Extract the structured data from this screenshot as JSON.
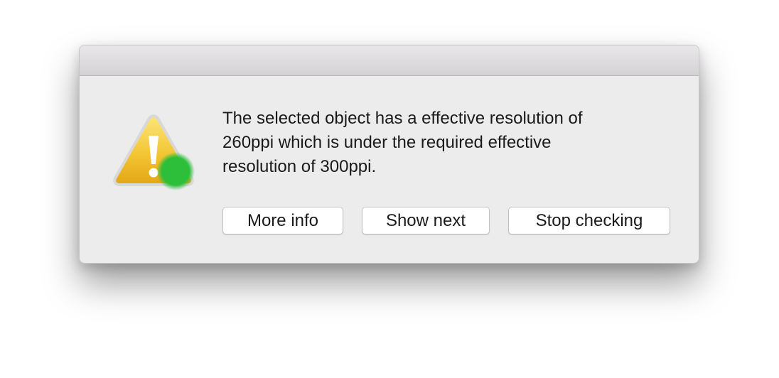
{
  "dialog": {
    "icon": "warning-icon",
    "message_line1": "The selected object has a effective resolution of",
    "message_line2": "260ppi which is under the required effective",
    "message_line3": "resolution of 300ppi.",
    "buttons": {
      "more_info": "More info",
      "show_next": "Show next",
      "stop_checking": "Stop checking"
    }
  },
  "colors": {
    "warning_yellow": "#f2c12e",
    "status_dot_green": "#2dbf3a",
    "dialog_background": "#ececec"
  }
}
